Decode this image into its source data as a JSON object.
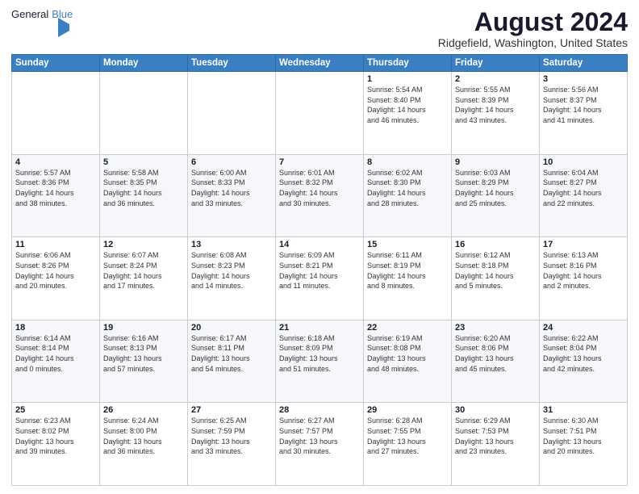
{
  "logo": {
    "line1": "General",
    "line2": "Blue"
  },
  "title": "August 2024",
  "subtitle": "Ridgefield, Washington, United States",
  "days_header": [
    "Sunday",
    "Monday",
    "Tuesday",
    "Wednesday",
    "Thursday",
    "Friday",
    "Saturday"
  ],
  "weeks": [
    [
      {
        "num": "",
        "detail": ""
      },
      {
        "num": "",
        "detail": ""
      },
      {
        "num": "",
        "detail": ""
      },
      {
        "num": "",
        "detail": ""
      },
      {
        "num": "1",
        "detail": "Sunrise: 5:54 AM\nSunset: 8:40 PM\nDaylight: 14 hours\nand 46 minutes."
      },
      {
        "num": "2",
        "detail": "Sunrise: 5:55 AM\nSunset: 8:39 PM\nDaylight: 14 hours\nand 43 minutes."
      },
      {
        "num": "3",
        "detail": "Sunrise: 5:56 AM\nSunset: 8:37 PM\nDaylight: 14 hours\nand 41 minutes."
      }
    ],
    [
      {
        "num": "4",
        "detail": "Sunrise: 5:57 AM\nSunset: 8:36 PM\nDaylight: 14 hours\nand 38 minutes."
      },
      {
        "num": "5",
        "detail": "Sunrise: 5:58 AM\nSunset: 8:35 PM\nDaylight: 14 hours\nand 36 minutes."
      },
      {
        "num": "6",
        "detail": "Sunrise: 6:00 AM\nSunset: 8:33 PM\nDaylight: 14 hours\nand 33 minutes."
      },
      {
        "num": "7",
        "detail": "Sunrise: 6:01 AM\nSunset: 8:32 PM\nDaylight: 14 hours\nand 30 minutes."
      },
      {
        "num": "8",
        "detail": "Sunrise: 6:02 AM\nSunset: 8:30 PM\nDaylight: 14 hours\nand 28 minutes."
      },
      {
        "num": "9",
        "detail": "Sunrise: 6:03 AM\nSunset: 8:29 PM\nDaylight: 14 hours\nand 25 minutes."
      },
      {
        "num": "10",
        "detail": "Sunrise: 6:04 AM\nSunset: 8:27 PM\nDaylight: 14 hours\nand 22 minutes."
      }
    ],
    [
      {
        "num": "11",
        "detail": "Sunrise: 6:06 AM\nSunset: 8:26 PM\nDaylight: 14 hours\nand 20 minutes."
      },
      {
        "num": "12",
        "detail": "Sunrise: 6:07 AM\nSunset: 8:24 PM\nDaylight: 14 hours\nand 17 minutes."
      },
      {
        "num": "13",
        "detail": "Sunrise: 6:08 AM\nSunset: 8:23 PM\nDaylight: 14 hours\nand 14 minutes."
      },
      {
        "num": "14",
        "detail": "Sunrise: 6:09 AM\nSunset: 8:21 PM\nDaylight: 14 hours\nand 11 minutes."
      },
      {
        "num": "15",
        "detail": "Sunrise: 6:11 AM\nSunset: 8:19 PM\nDaylight: 14 hours\nand 8 minutes."
      },
      {
        "num": "16",
        "detail": "Sunrise: 6:12 AM\nSunset: 8:18 PM\nDaylight: 14 hours\nand 5 minutes."
      },
      {
        "num": "17",
        "detail": "Sunrise: 6:13 AM\nSunset: 8:16 PM\nDaylight: 14 hours\nand 2 minutes."
      }
    ],
    [
      {
        "num": "18",
        "detail": "Sunrise: 6:14 AM\nSunset: 8:14 PM\nDaylight: 14 hours\nand 0 minutes."
      },
      {
        "num": "19",
        "detail": "Sunrise: 6:16 AM\nSunset: 8:13 PM\nDaylight: 13 hours\nand 57 minutes."
      },
      {
        "num": "20",
        "detail": "Sunrise: 6:17 AM\nSunset: 8:11 PM\nDaylight: 13 hours\nand 54 minutes."
      },
      {
        "num": "21",
        "detail": "Sunrise: 6:18 AM\nSunset: 8:09 PM\nDaylight: 13 hours\nand 51 minutes."
      },
      {
        "num": "22",
        "detail": "Sunrise: 6:19 AM\nSunset: 8:08 PM\nDaylight: 13 hours\nand 48 minutes."
      },
      {
        "num": "23",
        "detail": "Sunrise: 6:20 AM\nSunset: 8:06 PM\nDaylight: 13 hours\nand 45 minutes."
      },
      {
        "num": "24",
        "detail": "Sunrise: 6:22 AM\nSunset: 8:04 PM\nDaylight: 13 hours\nand 42 minutes."
      }
    ],
    [
      {
        "num": "25",
        "detail": "Sunrise: 6:23 AM\nSunset: 8:02 PM\nDaylight: 13 hours\nand 39 minutes."
      },
      {
        "num": "26",
        "detail": "Sunrise: 6:24 AM\nSunset: 8:00 PM\nDaylight: 13 hours\nand 36 minutes."
      },
      {
        "num": "27",
        "detail": "Sunrise: 6:25 AM\nSunset: 7:59 PM\nDaylight: 13 hours\nand 33 minutes."
      },
      {
        "num": "28",
        "detail": "Sunrise: 6:27 AM\nSunset: 7:57 PM\nDaylight: 13 hours\nand 30 minutes."
      },
      {
        "num": "29",
        "detail": "Sunrise: 6:28 AM\nSunset: 7:55 PM\nDaylight: 13 hours\nand 27 minutes."
      },
      {
        "num": "30",
        "detail": "Sunrise: 6:29 AM\nSunset: 7:53 PM\nDaylight: 13 hours\nand 23 minutes."
      },
      {
        "num": "31",
        "detail": "Sunrise: 6:30 AM\nSunset: 7:51 PM\nDaylight: 13 hours\nand 20 minutes."
      }
    ]
  ]
}
